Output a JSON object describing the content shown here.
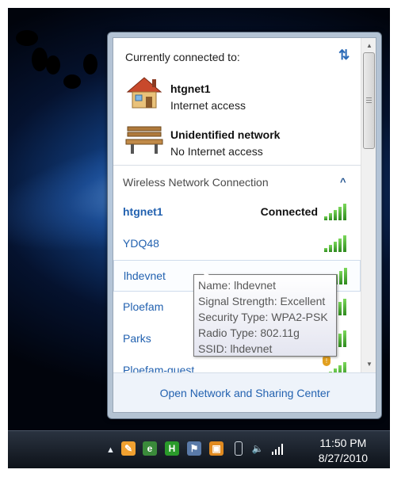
{
  "flyout": {
    "currently_connected_label": "Currently connected to:",
    "connected": [
      {
        "name": "htgnet1",
        "status": "Internet access",
        "icon": "house-icon"
      },
      {
        "name": "Unidentified network",
        "status": "No Internet access",
        "icon": "bench-icon"
      }
    ],
    "section_title": "Wireless Network Connection",
    "networks": [
      {
        "name": "htgnet1",
        "status": "Connected",
        "signal": 5
      },
      {
        "name": "YDQ48",
        "status": "",
        "signal": 5
      },
      {
        "name": "lhdevnet",
        "status": "",
        "signal": 5
      },
      {
        "name": "Ploefam",
        "status": "",
        "signal": 5
      },
      {
        "name": "Parks",
        "status": "",
        "signal": 5
      },
      {
        "name": "Ploefam-guest",
        "status": "",
        "signal": 5,
        "security": "shield-icon"
      }
    ],
    "tooltip": [
      "Name: lhdevnet",
      "Signal Strength: Excellent",
      "Security Type: WPA2-PSK",
      "Radio Type: 802.11g",
      "SSID: lhdevnet"
    ],
    "footer_link": "Open Network and Sharing Center"
  },
  "taskbar": {
    "time": "11:50 PM",
    "date": "8/27/2010"
  }
}
